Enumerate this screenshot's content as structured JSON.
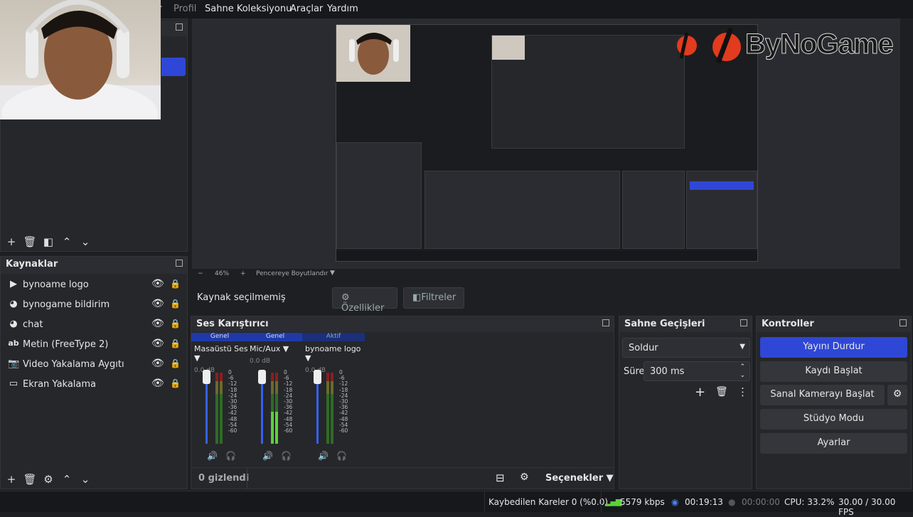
{
  "menu": {
    "items": [
      "Profil",
      "Sahne Koleksiyonu",
      "Araçlar",
      "Yardım"
    ],
    "partial_first": "r"
  },
  "watermark": {
    "text": "ByNoGame"
  },
  "sources": {
    "title": "Kaynaklar",
    "items": [
      {
        "label": "bynoame logo",
        "icon": "play-icon"
      },
      {
        "label": "bynogame bildirim",
        "icon": "globe-icon"
      },
      {
        "label": "chat",
        "icon": "globe-icon"
      },
      {
        "label": "Metin (FreeType 2)",
        "icon": "text-icon"
      },
      {
        "label": "Video Yakalama Aygıtı",
        "icon": "camera-icon"
      },
      {
        "label": "Ekran Yakalama",
        "icon": "monitor-icon"
      }
    ]
  },
  "zoom": {
    "minus": "−",
    "value": "46%",
    "plus": "+",
    "fit": "Pencereye Boyutlandır"
  },
  "context": {
    "status": "Kaynak seçilmemiş",
    "properties": "Özellikler",
    "filters": "Filtreler"
  },
  "mixer": {
    "title": "Ses Karıştırıcı",
    "hidden_count": "0 gizlendi",
    "options": "Seçenekler",
    "channels": [
      {
        "head": "Genel",
        "name": "Masaüstü Ses",
        "db": "0.0 dB",
        "level": 0.05
      },
      {
        "head": "Genel",
        "name": "Mic/Aux",
        "db": "0.0 dB",
        "level": 0.45
      },
      {
        "head": "Aktif",
        "name": "bynoame logo",
        "db": "0.0 dB",
        "level": 0.0
      }
    ],
    "scale": [
      "0",
      "-6",
      "-12",
      "-18",
      "-24",
      "-30",
      "-36",
      "-42",
      "-48",
      "-54",
      "-60"
    ]
  },
  "transitions": {
    "title": "Sahne Geçişleri",
    "selected": "Soldur",
    "duration_label": "Süre",
    "duration_value": "300 ms"
  },
  "controls": {
    "title": "Kontroller",
    "stop_stream": "Yayını Durdur",
    "start_record": "Kaydı Başlat",
    "start_virtualcam": "Sanal Kamerayı Başlat",
    "studio_mode": "Stüdyo Modu",
    "settings": "Ayarlar"
  },
  "status": {
    "dropped": "Kaybedilen Kareler 0 (%0.0)",
    "bitrate": "5579 kbps",
    "stream_time": "00:19:13",
    "record_time": "00:00:00",
    "cpu": "CPU: 33.2%",
    "fps": "30.00 / 30.00 FPS"
  },
  "colors": {
    "accent": "#2f47d6",
    "panel": "#26272b",
    "meter_green": "#5ad33a"
  }
}
